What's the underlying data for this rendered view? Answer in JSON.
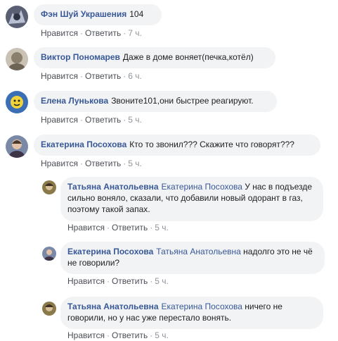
{
  "comments": [
    {
      "author": "Фэн Шуй Украшения",
      "text": "104",
      "like": "Нравится",
      "reply": "Ответить",
      "time": "7 ч."
    },
    {
      "author": "Виктор Пономарев",
      "text": "Даже в доме воняет(печка,котёл)",
      "like": "Нравится",
      "reply": "Ответить",
      "time": "6 ч."
    },
    {
      "author": "Елена Лунькова",
      "text": "Звоните101,они быстрее реагируют.",
      "like": "Нравится",
      "reply": "Ответить",
      "time": "5 ч."
    },
    {
      "author": "Екатерина Посохова",
      "text": "Кто то звонил??? Скажите что говорят???",
      "like": "Нравится",
      "reply": "Ответить",
      "time": "5 ч."
    }
  ],
  "replies": [
    {
      "author": "Татьяна Анатольевна",
      "mention": "Екатерина Посохова",
      "text": "У нас в подъезде сильно воняло, сказали, что добавили новый одорант в газ, поэтому такой запах.",
      "like": "Нравится",
      "reply": "Ответить",
      "time": "5 ч."
    },
    {
      "author": "Екатерина Посохова",
      "mention": "Татьяна Анатольевна",
      "text": "надолго это не чё не говорили?",
      "like": "Нравится",
      "reply": "Ответить",
      "time": "5 ч."
    },
    {
      "author": "Татьяна Анатольевна",
      "mention": "Екатерина Посохова",
      "text": "ничего не говорили, но у нас уже перестало вонять.",
      "like": "Нравится",
      "reply": "Ответить",
      "time": "5 ч."
    }
  ],
  "colors": {
    "link": "#385898",
    "bubble": "#f2f3f5",
    "meta": "#90949c"
  }
}
